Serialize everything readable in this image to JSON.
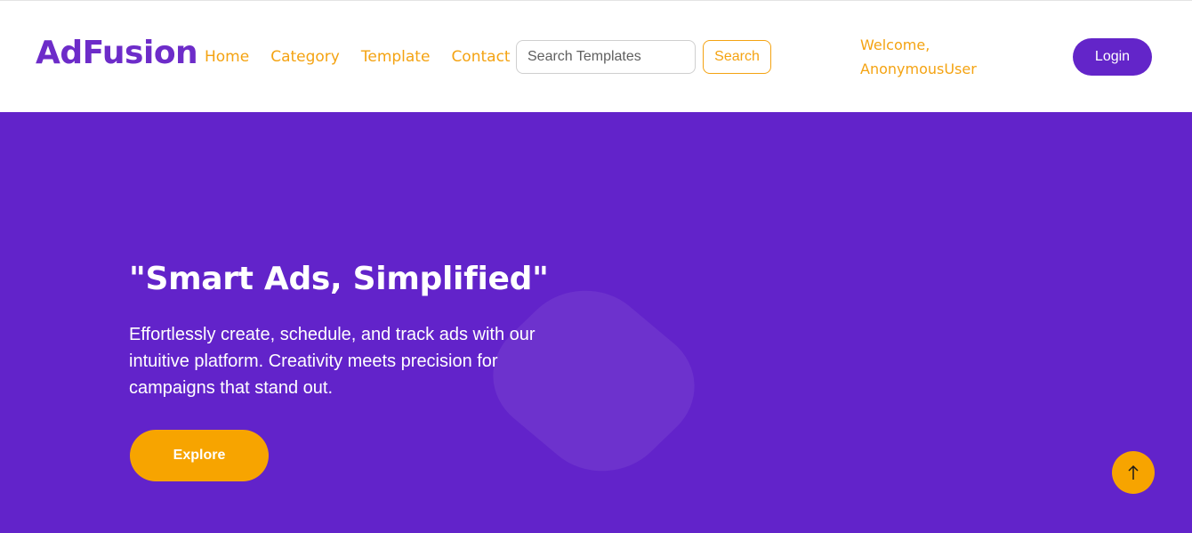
{
  "header": {
    "logo": "AdFusion",
    "nav": [
      {
        "label": "Home"
      },
      {
        "label": "Category"
      },
      {
        "label": "Template"
      },
      {
        "label": "Contact"
      }
    ],
    "search": {
      "placeholder": "Search Templates",
      "value": "",
      "button_label": "Search"
    },
    "welcome": {
      "line1": "Welcome,",
      "line2": "AnonymousUser"
    },
    "login_label": "Login"
  },
  "hero": {
    "title": "\"Smart Ads, Simplified\"",
    "description": "Effortlessly create, schedule, and track ads with our intuitive platform. Creativity meets precision for campaigns that stand out.",
    "cta_label": "Explore"
  },
  "scroll_top": {
    "icon": "arrow-up-icon"
  },
  "colors": {
    "brand_purple": "#6223ca",
    "logo_purple": "#6d2cc9",
    "accent_orange": "#f4a312",
    "button_orange": "#f7a400",
    "login_purple": "#6325c9"
  }
}
